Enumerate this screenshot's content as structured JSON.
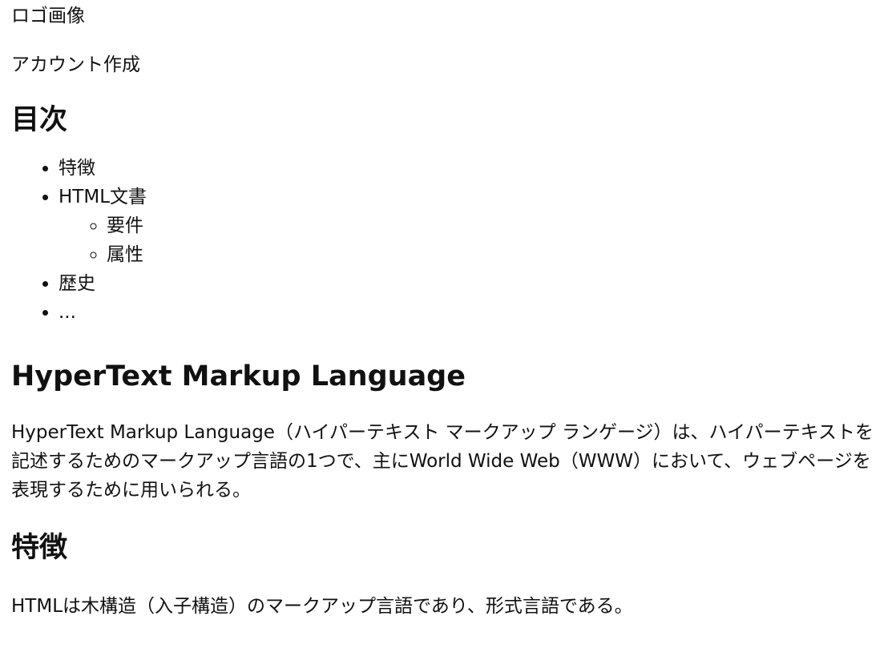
{
  "header": {
    "logo_text": "ロゴ画像",
    "account_link": "アカウント作成"
  },
  "toc": {
    "title": "目次",
    "items": [
      {
        "label": "特徴"
      },
      {
        "label": "HTML文書",
        "children": [
          {
            "label": "要件"
          },
          {
            "label": "属性"
          }
        ]
      },
      {
        "label": "歴史"
      },
      {
        "label": "..."
      }
    ]
  },
  "article": {
    "title": "HyperText Markup Language",
    "intro": "HyperText Markup Language（ハイパーテキスト マークアップ ランゲージ）は、ハイパーテキストを記述するためのマークアップ言語の1つで、主にWorld Wide Web（WWW）において、ウェブページを表現するために用いられる。",
    "sections": [
      {
        "title": "特徴",
        "text": "HTMLは木構造（入子構造）のマークアップ言語であり、形式言語である。"
      }
    ]
  }
}
